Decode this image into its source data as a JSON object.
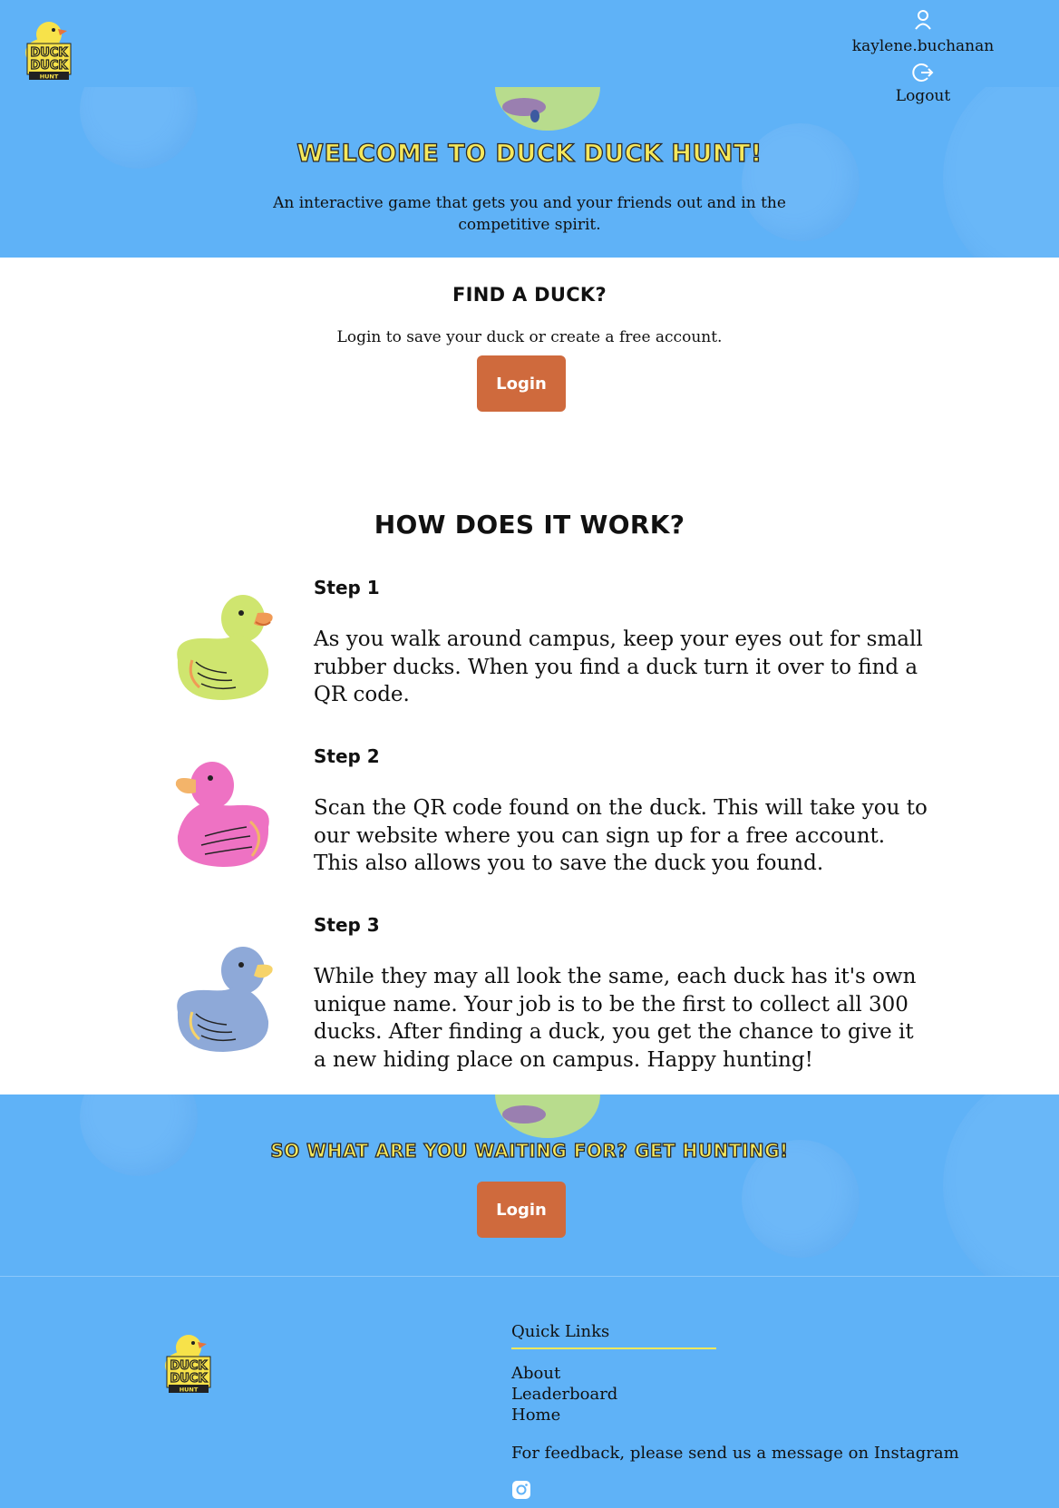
{
  "header": {
    "logo_alt": "Duck Duck Hunt",
    "username": "kaylene.buchanan",
    "logout_label": "Logout",
    "icons": {
      "user": "user-icon",
      "logout": "logout-icon"
    }
  },
  "hero": {
    "title": "Welcome to Duck Duck Hunt!",
    "subtitle": "An interactive game that gets you and your friends out and in the competitive spirit."
  },
  "find": {
    "title": "Find a Duck?",
    "text": "Login to save your duck or create a free account.",
    "login_label": "Login"
  },
  "how": {
    "title": "How does it work?",
    "steps": [
      {
        "label": "Step 1",
        "text": "As you walk around campus, keep your eyes out for small rubber ducks. When you find a duck turn it over to find a QR code.",
        "duck_color": "#cfe56f"
      },
      {
        "label": "Step 2",
        "text": "Scan the QR code found on the duck. This will take you to our website where you can sign up for a free account. This also allows you to save the duck you found.",
        "duck_color": "#ee72c3"
      },
      {
        "label": "Step 3",
        "text": "While they may all look the same, each duck has it's own unique name. Your job is to be the first to collect all 300 ducks. After finding a duck, you get the chance to give it a new hiding place on campus. Happy hunting!",
        "duck_color": "#8ea9d8"
      }
    ]
  },
  "cta": {
    "title": "So what are you waiting for? Get hunting!",
    "login_label": "Login"
  },
  "footer": {
    "quick_links_title": "Quick Links",
    "links": [
      "About",
      "Leaderboard",
      "Home"
    ],
    "feedback": "For feedback, please send us a message on Instagram",
    "instagram_icon": "instagram-icon"
  },
  "colors": {
    "primary_blue": "#5fb2f7",
    "button_orange": "#cf6a3d",
    "title_yellow": "#f5e85c"
  }
}
